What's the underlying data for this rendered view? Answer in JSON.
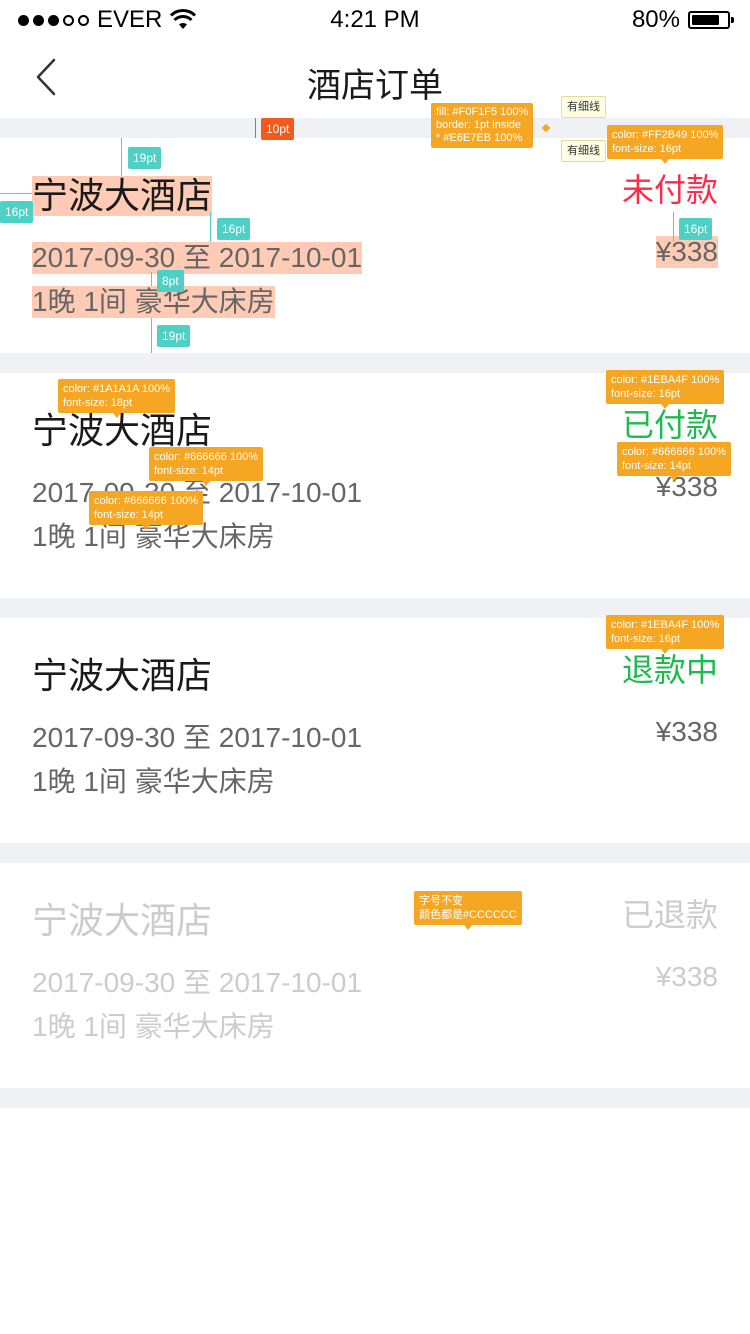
{
  "status_bar": {
    "carrier": "EVER",
    "time": "4:21 PM",
    "battery": "80%",
    "battery_level": 0.8,
    "signal_dots_filled": 3,
    "signal_dots_total": 5
  },
  "nav": {
    "title": "酒店订单",
    "back_icon": "chevron-left-icon"
  },
  "orders": [
    {
      "hotel": "宁波大酒店",
      "dates": "2017-09-30 至 2017-10-01",
      "room": "1晚 1间 豪华大床房",
      "status": "未付款",
      "status_color": "#FF2B49",
      "price": "¥338"
    },
    {
      "hotel": "宁波大酒店",
      "dates": "2017-09-30 至 2017-10-01",
      "room": "1晚 1间 豪华大床房",
      "status": "已付款",
      "status_color": "#1EBA4F",
      "price": "¥338"
    },
    {
      "hotel": "宁波大酒店",
      "dates": "2017-09-30 至 2017-10-01",
      "room": "1晚 1间 豪华大床房",
      "status": "退款中",
      "status_color": "#1EBA4F",
      "price": "¥338"
    },
    {
      "hotel": "宁波大酒店",
      "dates": "2017-09-30 至 2017-10-01",
      "room": "1晚 1间 豪华大床房",
      "status": "已退款",
      "status_color": "#CCCCCC",
      "price": "¥338"
    }
  ],
  "annotations": {
    "gap_10pt": "10pt",
    "top_19pt": "19pt",
    "left_16pt": "16pt",
    "hotel_dates_16pt": "16pt",
    "dates_room_8pt": "8pt",
    "bottom_19pt": "19pt",
    "status_price_16pt": "16pt",
    "fill_line1": "fill: #F0F1F5 100%",
    "fill_line2": "border: 1pt inside",
    "fill_line3": "* #E6E7EB 100%",
    "hairline_1": "有细线",
    "hairline_2": "有细线",
    "red_status_1": "color: #FF2B49 100%",
    "red_status_2": "font-size: 16pt",
    "title_spec_1": "color: #1A1A1A 100%",
    "title_spec_2": "font-size: 18pt",
    "green_spec_1": "color: #1EBA4F 100%",
    "green_spec_2": "font-size: 16pt",
    "dates_spec_1": "color: #666666 100%",
    "dates_spec_2": "font-size: 14pt",
    "room_spec_1": "color: #666666 100%",
    "room_spec_2": "font-size: 14pt",
    "price_spec_1": "color: #666666 100%",
    "price_spec_2": "font-size: 14pt",
    "green2_spec_1": "color: #1EBA4F 100%",
    "green2_spec_2": "font-size: 16pt",
    "grey_note_1": "字号不变",
    "grey_note_2": "颜色都是#CCCCCC"
  }
}
